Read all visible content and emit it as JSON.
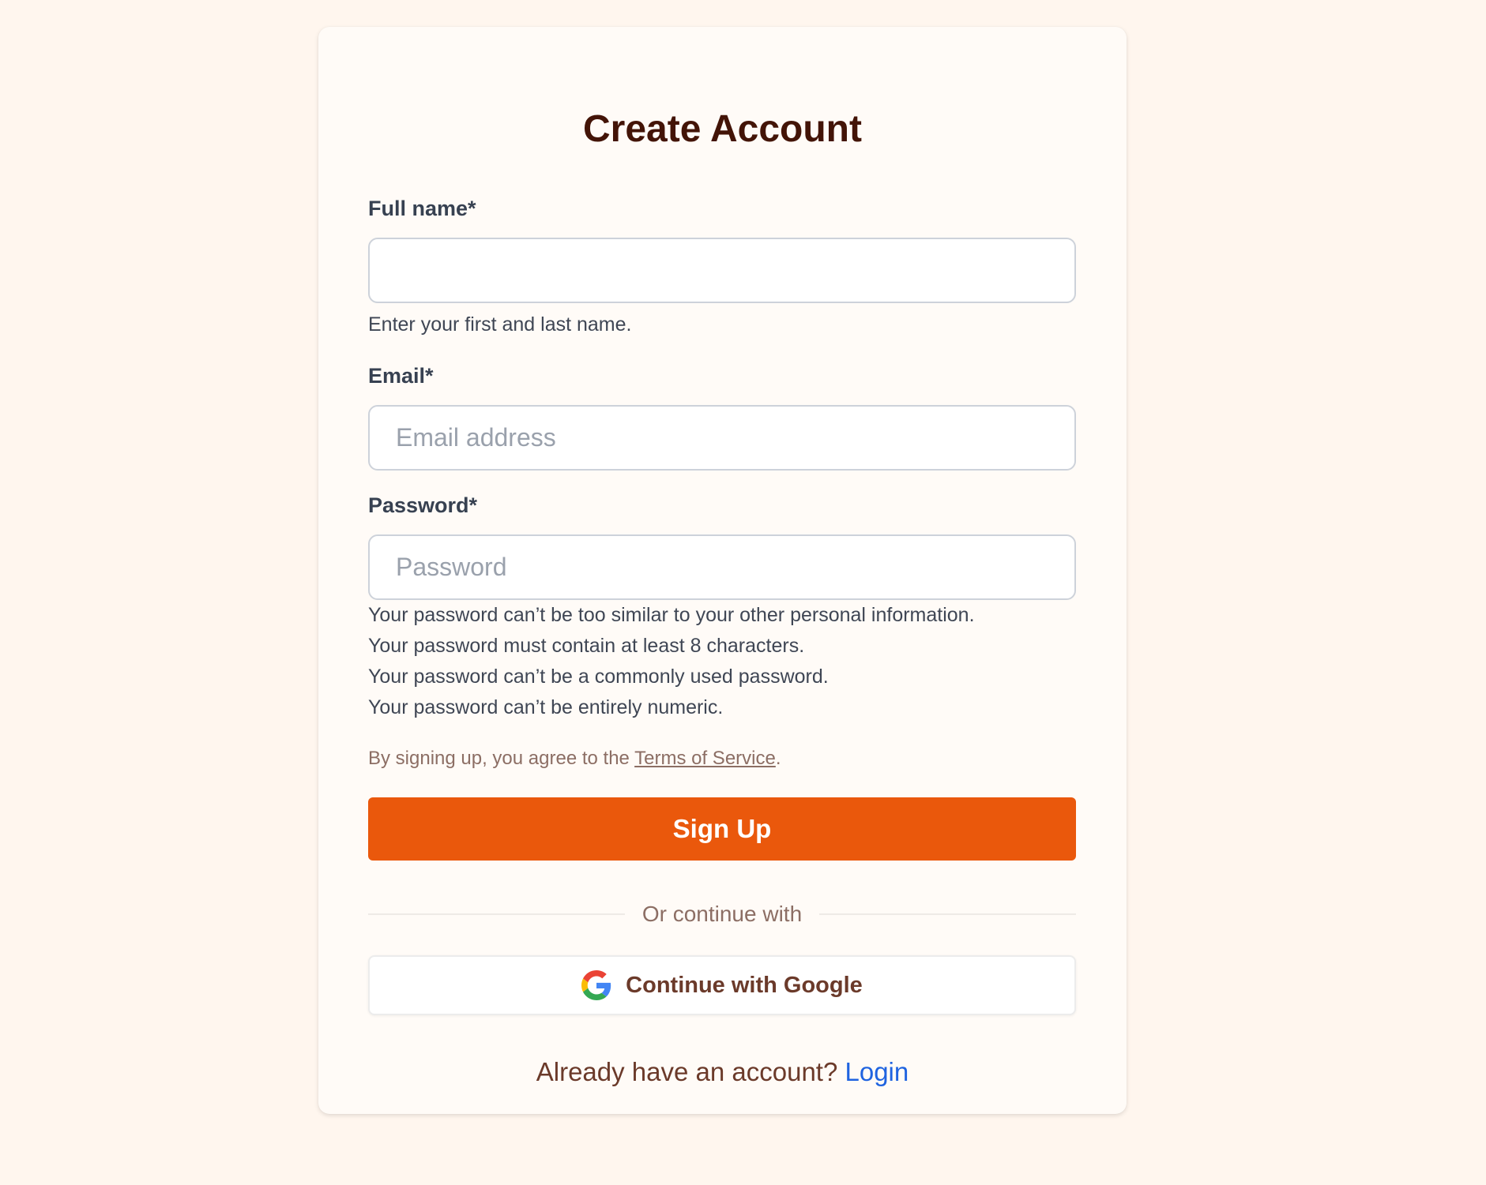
{
  "form": {
    "title": "Create Account",
    "full_name": {
      "label": "Full name*",
      "value": "",
      "placeholder": "",
      "help": "Enter your first and last name."
    },
    "email": {
      "label": "Email*",
      "value": "",
      "placeholder": "Email address"
    },
    "password": {
      "label": "Password*",
      "value": "",
      "placeholder": "Password",
      "help": [
        "Your password can’t be too similar to your other personal information.",
        "Your password must contain at least 8 characters.",
        "Your password can’t be a commonly used password.",
        "Your password can’t be entirely numeric."
      ]
    },
    "terms": {
      "prefix": "By signing up, you agree to the ",
      "link": "Terms of Service",
      "suffix": "."
    },
    "submit_label": "Sign Up",
    "divider_text": "Or continue with",
    "google_label": "Continue with Google",
    "google_icon": "google-logo-icon",
    "footer": {
      "text": "Already have an account? ",
      "link": "Login"
    }
  },
  "colors": {
    "background": "#fff6ee",
    "card": "#fffbf7",
    "accent": "#ea580c",
    "title": "#431407",
    "link": "#1f63e0"
  }
}
